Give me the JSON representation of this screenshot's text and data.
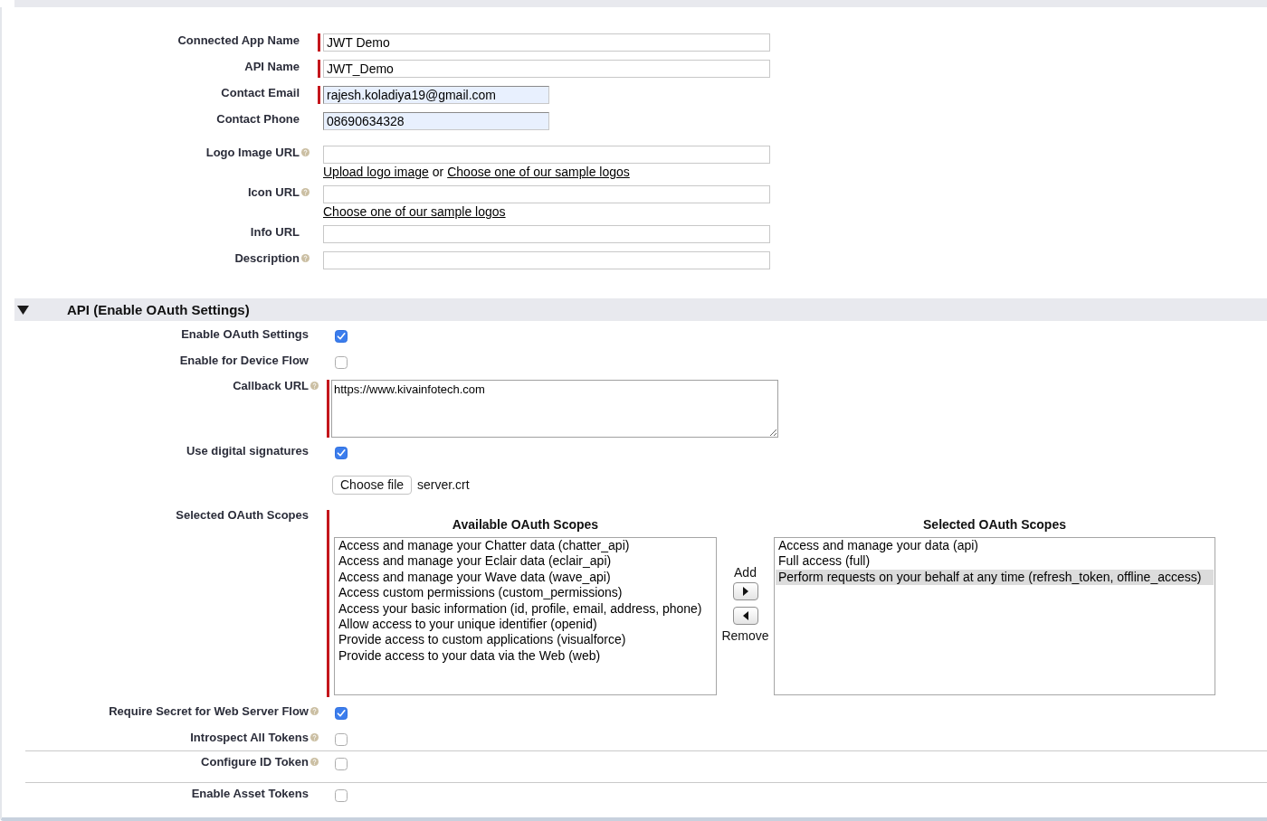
{
  "app_info": {
    "fields": [
      {
        "label": "Connected App Name",
        "kind": "text",
        "value": "JWT Demo",
        "required": true,
        "help": false,
        "autofilled": false
      },
      {
        "label": "API Name",
        "kind": "text",
        "value": "JWT_Demo",
        "required": true,
        "help": false,
        "autofilled": false
      },
      {
        "label": "Contact Email",
        "kind": "email",
        "value": "rajesh.koladiya19@gmail.com",
        "required": true,
        "help": false,
        "autofilled": true
      },
      {
        "label": "Contact Phone",
        "kind": "tel",
        "value": "08690634328",
        "required": false,
        "help": false,
        "autofilled": true
      },
      {
        "label": "Logo Image URL",
        "kind": "url",
        "required": false,
        "help": true,
        "autofilled": false,
        "links": [
          {
            "kind": "link",
            "text": "Upload logo image"
          },
          {
            "kind": "text",
            "text": "or"
          },
          {
            "kind": "link",
            "text": "Choose one of our sample logos"
          }
        ]
      },
      {
        "label": "Icon URL",
        "kind": "url",
        "required": false,
        "help": true,
        "autofilled": false,
        "links": [
          {
            "kind": "link",
            "text": "Choose one of our sample logos"
          }
        ]
      },
      {
        "label": "Info URL",
        "kind": "url",
        "required": false,
        "help": false,
        "autofilled": false
      },
      {
        "label": "Description",
        "kind": "text",
        "required": false,
        "help": true,
        "autofilled": false
      }
    ]
  },
  "oauth_section": {
    "title": "API (Enable OAuth Settings)",
    "expanded": true,
    "rows": [
      {
        "kind": "checkbox",
        "label": "Enable OAuth Settings",
        "checked": true,
        "help": false,
        "divider": false
      },
      {
        "kind": "checkbox",
        "label": "Enable for Device Flow",
        "checked": false,
        "help": false,
        "divider": false
      },
      {
        "kind": "textarea",
        "label": "Callback URL",
        "value": "https://www.kivainfotech.com",
        "required": true,
        "help": true,
        "divider": false
      },
      {
        "kind": "checkbox",
        "label": "Use digital signatures",
        "checked": true,
        "help": false,
        "divider": false
      },
      {
        "kind": "file",
        "button": "Choose file",
        "file_name": "server.crt",
        "divider": false
      },
      {
        "kind": "scopes",
        "label": "Selected OAuth Scopes",
        "required": true,
        "help": false,
        "divider": false,
        "available": {
          "title": "Available OAuth Scopes",
          "options": [
            {
              "text": "Access and manage your Chatter data (chatter_api)",
              "selected": false
            },
            {
              "text": "Access and manage your Eclair data (eclair_api)",
              "selected": false
            },
            {
              "text": "Access and manage your Wave data (wave_api)",
              "selected": false
            },
            {
              "text": "Access custom permissions (custom_permissions)",
              "selected": false
            },
            {
              "text": "Access your basic information (id, profile, email, address, phone)",
              "selected": false
            },
            {
              "text": "Allow access to your unique identifier (openid)",
              "selected": false
            },
            {
              "text": "Provide access to custom applications (visualforce)",
              "selected": false
            },
            {
              "text": "Provide access to your data via the Web (web)",
              "selected": false
            }
          ]
        },
        "add": "Add",
        "remove": "Remove",
        "chosen": {
          "title": "Selected OAuth Scopes",
          "options": [
            {
              "text": "Access and manage your data (api)",
              "selected": false
            },
            {
              "text": "Full access (full)",
              "selected": false
            },
            {
              "text": "Perform requests on your behalf at any time (refresh_token, offline_access)",
              "selected": true
            }
          ]
        }
      },
      {
        "kind": "checkbox",
        "label": "Require Secret for Web Server Flow",
        "checked": true,
        "help": true,
        "divider": false
      },
      {
        "kind": "checkbox",
        "label": "Introspect All Tokens",
        "checked": false,
        "help": true,
        "divider": false
      },
      {
        "kind": "checkbox",
        "label": "Configure ID Token",
        "checked": false,
        "help": true,
        "divider": true
      },
      {
        "kind": "checkbox",
        "label": "Enable Asset Tokens",
        "checked": false,
        "help": false,
        "divider": true
      }
    ]
  }
}
